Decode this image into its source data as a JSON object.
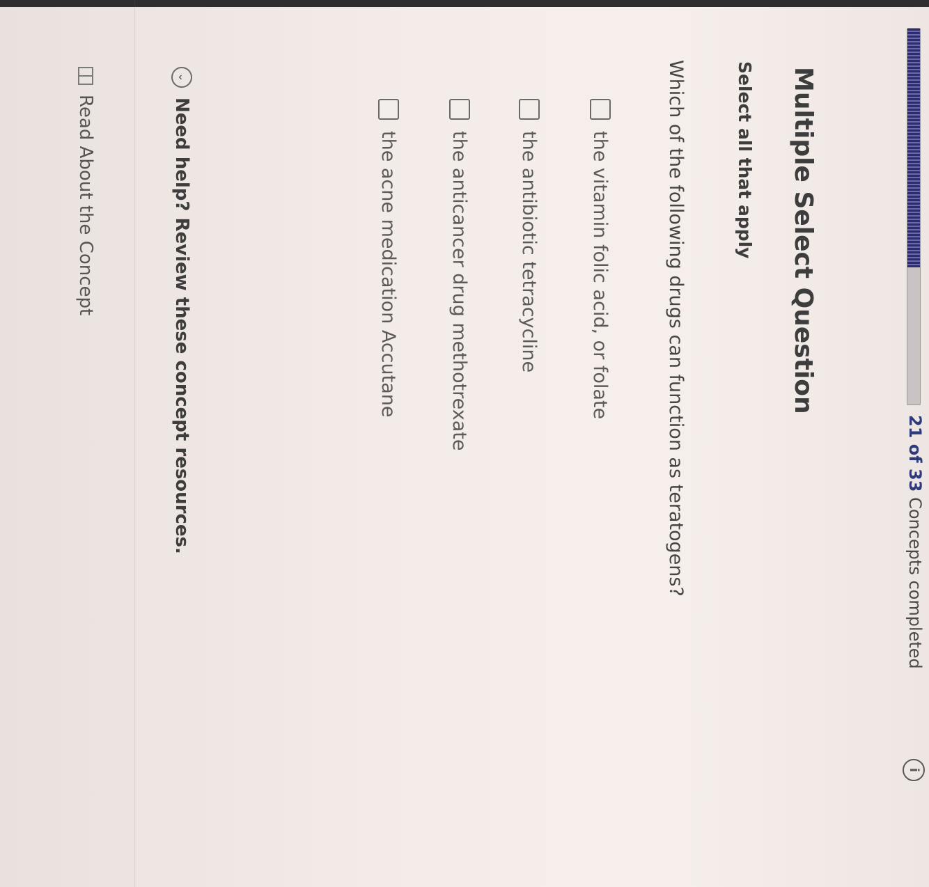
{
  "progress": {
    "count": "21 of 33",
    "suffix": " Concepts completed",
    "fraction": 0.636
  },
  "info_icon": "i",
  "question": {
    "type_title": "Multiple Select Question",
    "instruction": "Select all that apply",
    "prompt": "Which of the following drugs can function as teratogens?",
    "options": [
      {
        "label": "the vitamin folic acid, or folate",
        "checked": false
      },
      {
        "label": "the antibiotic tetracycline",
        "checked": false
      },
      {
        "label": "the anticancer drug methotrexate",
        "checked": false
      },
      {
        "label": "the acne medication Accutane",
        "checked": false
      }
    ]
  },
  "help": {
    "text": "Need help? Review these concept resources.",
    "chevron_icon": "chevron-down-icon"
  },
  "resources": {
    "read_concept": "Read About the Concept",
    "icon": "book-icon"
  }
}
